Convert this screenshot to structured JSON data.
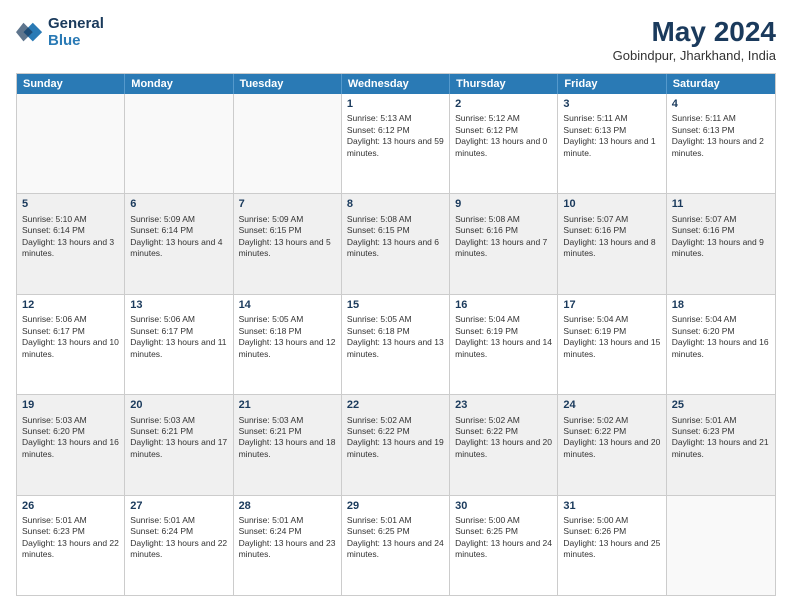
{
  "header": {
    "logo_line1": "General",
    "logo_line2": "Blue",
    "month_year": "May 2024",
    "location": "Gobindpur, Jharkhand, India"
  },
  "days_of_week": [
    "Sunday",
    "Monday",
    "Tuesday",
    "Wednesday",
    "Thursday",
    "Friday",
    "Saturday"
  ],
  "rows": [
    {
      "shaded": false,
      "cells": [
        {
          "day": "",
          "empty": true
        },
        {
          "day": "",
          "empty": true
        },
        {
          "day": "",
          "empty": true
        },
        {
          "day": "1",
          "sunrise": "Sunrise: 5:13 AM",
          "sunset": "Sunset: 6:12 PM",
          "daylight": "Daylight: 13 hours and 59 minutes."
        },
        {
          "day": "2",
          "sunrise": "Sunrise: 5:12 AM",
          "sunset": "Sunset: 6:12 PM",
          "daylight": "Daylight: 13 hours and 0 minutes."
        },
        {
          "day": "3",
          "sunrise": "Sunrise: 5:11 AM",
          "sunset": "Sunset: 6:13 PM",
          "daylight": "Daylight: 13 hours and 1 minute."
        },
        {
          "day": "4",
          "sunrise": "Sunrise: 5:11 AM",
          "sunset": "Sunset: 6:13 PM",
          "daylight": "Daylight: 13 hours and 2 minutes."
        }
      ]
    },
    {
      "shaded": true,
      "cells": [
        {
          "day": "5",
          "sunrise": "Sunrise: 5:10 AM",
          "sunset": "Sunset: 6:14 PM",
          "daylight": "Daylight: 13 hours and 3 minutes."
        },
        {
          "day": "6",
          "sunrise": "Sunrise: 5:09 AM",
          "sunset": "Sunset: 6:14 PM",
          "daylight": "Daylight: 13 hours and 4 minutes."
        },
        {
          "day": "7",
          "sunrise": "Sunrise: 5:09 AM",
          "sunset": "Sunset: 6:15 PM",
          "daylight": "Daylight: 13 hours and 5 minutes."
        },
        {
          "day": "8",
          "sunrise": "Sunrise: 5:08 AM",
          "sunset": "Sunset: 6:15 PM",
          "daylight": "Daylight: 13 hours and 6 minutes."
        },
        {
          "day": "9",
          "sunrise": "Sunrise: 5:08 AM",
          "sunset": "Sunset: 6:16 PM",
          "daylight": "Daylight: 13 hours and 7 minutes."
        },
        {
          "day": "10",
          "sunrise": "Sunrise: 5:07 AM",
          "sunset": "Sunset: 6:16 PM",
          "daylight": "Daylight: 13 hours and 8 minutes."
        },
        {
          "day": "11",
          "sunrise": "Sunrise: 5:07 AM",
          "sunset": "Sunset: 6:16 PM",
          "daylight": "Daylight: 13 hours and 9 minutes."
        }
      ]
    },
    {
      "shaded": false,
      "cells": [
        {
          "day": "12",
          "sunrise": "Sunrise: 5:06 AM",
          "sunset": "Sunset: 6:17 PM",
          "daylight": "Daylight: 13 hours and 10 minutes."
        },
        {
          "day": "13",
          "sunrise": "Sunrise: 5:06 AM",
          "sunset": "Sunset: 6:17 PM",
          "daylight": "Daylight: 13 hours and 11 minutes."
        },
        {
          "day": "14",
          "sunrise": "Sunrise: 5:05 AM",
          "sunset": "Sunset: 6:18 PM",
          "daylight": "Daylight: 13 hours and 12 minutes."
        },
        {
          "day": "15",
          "sunrise": "Sunrise: 5:05 AM",
          "sunset": "Sunset: 6:18 PM",
          "daylight": "Daylight: 13 hours and 13 minutes."
        },
        {
          "day": "16",
          "sunrise": "Sunrise: 5:04 AM",
          "sunset": "Sunset: 6:19 PM",
          "daylight": "Daylight: 13 hours and 14 minutes."
        },
        {
          "day": "17",
          "sunrise": "Sunrise: 5:04 AM",
          "sunset": "Sunset: 6:19 PM",
          "daylight": "Daylight: 13 hours and 15 minutes."
        },
        {
          "day": "18",
          "sunrise": "Sunrise: 5:04 AM",
          "sunset": "Sunset: 6:20 PM",
          "daylight": "Daylight: 13 hours and 16 minutes."
        }
      ]
    },
    {
      "shaded": true,
      "cells": [
        {
          "day": "19",
          "sunrise": "Sunrise: 5:03 AM",
          "sunset": "Sunset: 6:20 PM",
          "daylight": "Daylight: 13 hours and 16 minutes."
        },
        {
          "day": "20",
          "sunrise": "Sunrise: 5:03 AM",
          "sunset": "Sunset: 6:21 PM",
          "daylight": "Daylight: 13 hours and 17 minutes."
        },
        {
          "day": "21",
          "sunrise": "Sunrise: 5:03 AM",
          "sunset": "Sunset: 6:21 PM",
          "daylight": "Daylight: 13 hours and 18 minutes."
        },
        {
          "day": "22",
          "sunrise": "Sunrise: 5:02 AM",
          "sunset": "Sunset: 6:22 PM",
          "daylight": "Daylight: 13 hours and 19 minutes."
        },
        {
          "day": "23",
          "sunrise": "Sunrise: 5:02 AM",
          "sunset": "Sunset: 6:22 PM",
          "daylight": "Daylight: 13 hours and 20 minutes."
        },
        {
          "day": "24",
          "sunrise": "Sunrise: 5:02 AM",
          "sunset": "Sunset: 6:22 PM",
          "daylight": "Daylight: 13 hours and 20 minutes."
        },
        {
          "day": "25",
          "sunrise": "Sunrise: 5:01 AM",
          "sunset": "Sunset: 6:23 PM",
          "daylight": "Daylight: 13 hours and 21 minutes."
        }
      ]
    },
    {
      "shaded": false,
      "cells": [
        {
          "day": "26",
          "sunrise": "Sunrise: 5:01 AM",
          "sunset": "Sunset: 6:23 PM",
          "daylight": "Daylight: 13 hours and 22 minutes."
        },
        {
          "day": "27",
          "sunrise": "Sunrise: 5:01 AM",
          "sunset": "Sunset: 6:24 PM",
          "daylight": "Daylight: 13 hours and 22 minutes."
        },
        {
          "day": "28",
          "sunrise": "Sunrise: 5:01 AM",
          "sunset": "Sunset: 6:24 PM",
          "daylight": "Daylight: 13 hours and 23 minutes."
        },
        {
          "day": "29",
          "sunrise": "Sunrise: 5:01 AM",
          "sunset": "Sunset: 6:25 PM",
          "daylight": "Daylight: 13 hours and 24 minutes."
        },
        {
          "day": "30",
          "sunrise": "Sunrise: 5:00 AM",
          "sunset": "Sunset: 6:25 PM",
          "daylight": "Daylight: 13 hours and 24 minutes."
        },
        {
          "day": "31",
          "sunrise": "Sunrise: 5:00 AM",
          "sunset": "Sunset: 6:26 PM",
          "daylight": "Daylight: 13 hours and 25 minutes."
        },
        {
          "day": "",
          "empty": true
        }
      ]
    }
  ]
}
